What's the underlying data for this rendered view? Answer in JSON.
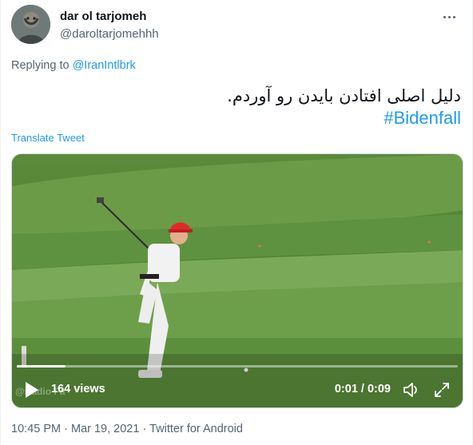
{
  "author": {
    "display_name": "dar ol tarjomeh",
    "handle": "@daroltarjomehhh",
    "avatar_icon": "avatar-photo"
  },
  "reply": {
    "prefix": "Replying to",
    "to": "@IranIntlbrk"
  },
  "tweet": {
    "text": "دلیل اصلی افتادن بایدن رو آوردم.",
    "hashtag": "#Bidenfall",
    "translate_label": "Translate Tweet"
  },
  "video": {
    "views": "164 views",
    "time": "0:01 / 0:09",
    "watermark": "@Radio Fa",
    "progress": 0.11,
    "play_icon": "play-icon",
    "volume_icon": "volume-icon",
    "fullscreen_icon": "fullscreen-icon"
  },
  "meta": {
    "time": "10:45 PM",
    "separator": "·",
    "date": "Mar 19, 2021",
    "source": "Twitter for Android"
  },
  "colors": {
    "accent": "#1d9bf0",
    "secondary_text": "#536471",
    "primary_text": "#0f1419"
  }
}
